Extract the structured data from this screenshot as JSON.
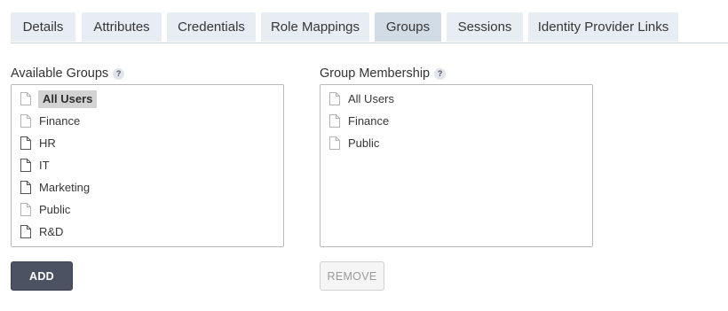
{
  "tabs": [
    {
      "label": "Details"
    },
    {
      "label": "Attributes"
    },
    {
      "label": "Credentials"
    },
    {
      "label": "Role Mappings"
    },
    {
      "label": "Groups",
      "active": true
    },
    {
      "label": "Sessions"
    },
    {
      "label": "Identity Provider Links"
    }
  ],
  "available_groups": {
    "label": "Available Groups",
    "help": "?",
    "items": [
      {
        "label": "All Users",
        "selected": true
      },
      {
        "label": "Finance"
      },
      {
        "label": "HR"
      },
      {
        "label": "IT"
      },
      {
        "label": "Marketing"
      },
      {
        "label": "Public"
      },
      {
        "label": "R&D"
      }
    ],
    "icon": "document-icon"
  },
  "group_membership": {
    "label": "Group Membership",
    "help": "?",
    "items": [
      {
        "label": "All Users"
      },
      {
        "label": "Finance"
      },
      {
        "label": "Public"
      }
    ],
    "icon": "document-icon"
  },
  "buttons": {
    "add_label": "ADD",
    "remove_label": "REMOVE"
  },
  "colors": {
    "tab_bg": "#e7edf3",
    "tab_active_bg": "#d2dce6",
    "add_button_bg": "#4d5263",
    "remove_button_bg": "#f5f5f5"
  }
}
